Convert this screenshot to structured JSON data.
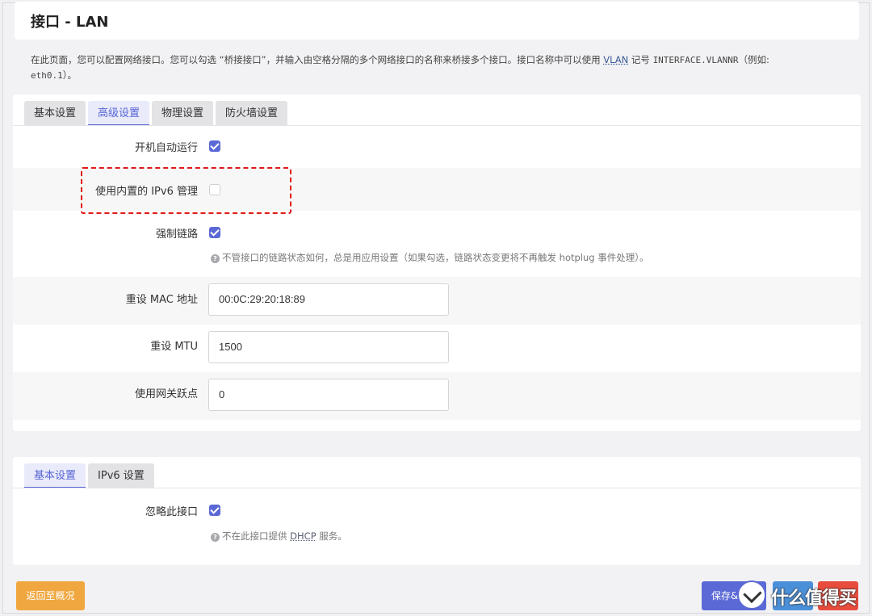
{
  "page": {
    "title": "接口 - LAN"
  },
  "description": {
    "part1": "在此页面，您可以配置网络接口。您可以勾选 “桥接接口”，并输入由空格分隔的多个网络接口的名称来桥接多个接口。接口名称中可以使用 ",
    "vlan": "VLAN",
    "part2": " 记号 ",
    "code1": "INTERFACE.VLANNR",
    "part3": "（例如: ",
    "code2": "eth0.1",
    "part4": "）。"
  },
  "interface_tabs": [
    "基本设置",
    "高级设置",
    "物理设置",
    "防火墙设置"
  ],
  "advanced": {
    "auto_start_label": "开机自动运行",
    "auto_start": true,
    "ipv6_label": "使用内置的 IPv6 管理",
    "ipv6": false,
    "force_link_label": "强制链路",
    "force_link": true,
    "force_link_hint": "不管接口的链路状态如何，总是用应用设置（如果勾选，链路状态变更将不再触发 hotplug 事件处理）。",
    "mac_label": "重设 MAC 地址",
    "mac_value": "00:0C:29:20:18:89",
    "mtu_label": "重设 MTU",
    "mtu_value": "1500",
    "metric_label": "使用网关跃点",
    "metric_value": "0"
  },
  "dhcp_tabs": [
    "基本设置",
    "IPv6 设置"
  ],
  "dhcp": {
    "ignore_label": "忽略此接口",
    "ignore": true,
    "hint_pre": "不在此接口提供 ",
    "hint_link": "DHCP",
    "hint_post": " 服务。"
  },
  "buttons": {
    "back": "返回至概况",
    "save": "保存&"
  },
  "watermark": "什么值得买",
  "colors": {
    "accent": "#5b69d6",
    "back": "#f0a740",
    "apply": "#4a90d9",
    "reset": "#e74c3c",
    "highlight": "#e01818"
  }
}
